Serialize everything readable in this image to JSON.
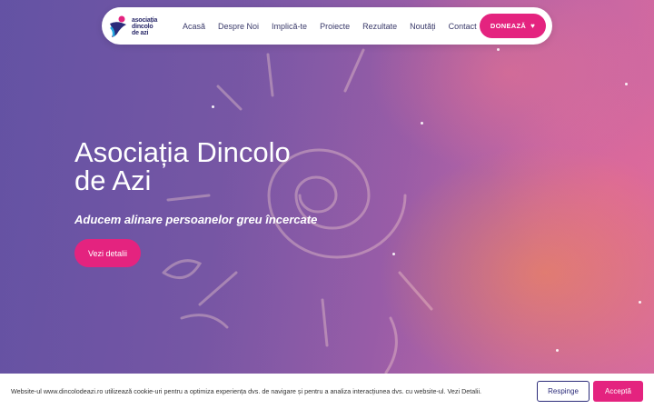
{
  "brand": {
    "logo_lines": [
      "asociația",
      "dincolo",
      "de azi"
    ],
    "colors": {
      "accent": "#e4237f",
      "nav_text": "#3a3a6a",
      "navy": "#2b2b7a"
    }
  },
  "nav": {
    "items": [
      "Acasă",
      "Despre Noi",
      "Implică-te",
      "Proiecte",
      "Rezultate",
      "Noutăți",
      "Contact"
    ],
    "donate_label": "DONEAZĂ",
    "donate_icon": "heart-icon"
  },
  "hero": {
    "title": "Asociația Dincolo de Azi",
    "subtitle": "Aducem alinare persoanelor greu încercate",
    "button_label": "Vezi detalii"
  },
  "cookie": {
    "text": "Website-ul www.dincolodeazi.ro utilizează cookie-uri pentru a optimiza experiența dvs. de navigare și pentru a analiza interacțiunea dvs. cu website-ul. Vezi Detalii.",
    "reject_label": "Respinge",
    "accept_label": "Acceptă"
  }
}
